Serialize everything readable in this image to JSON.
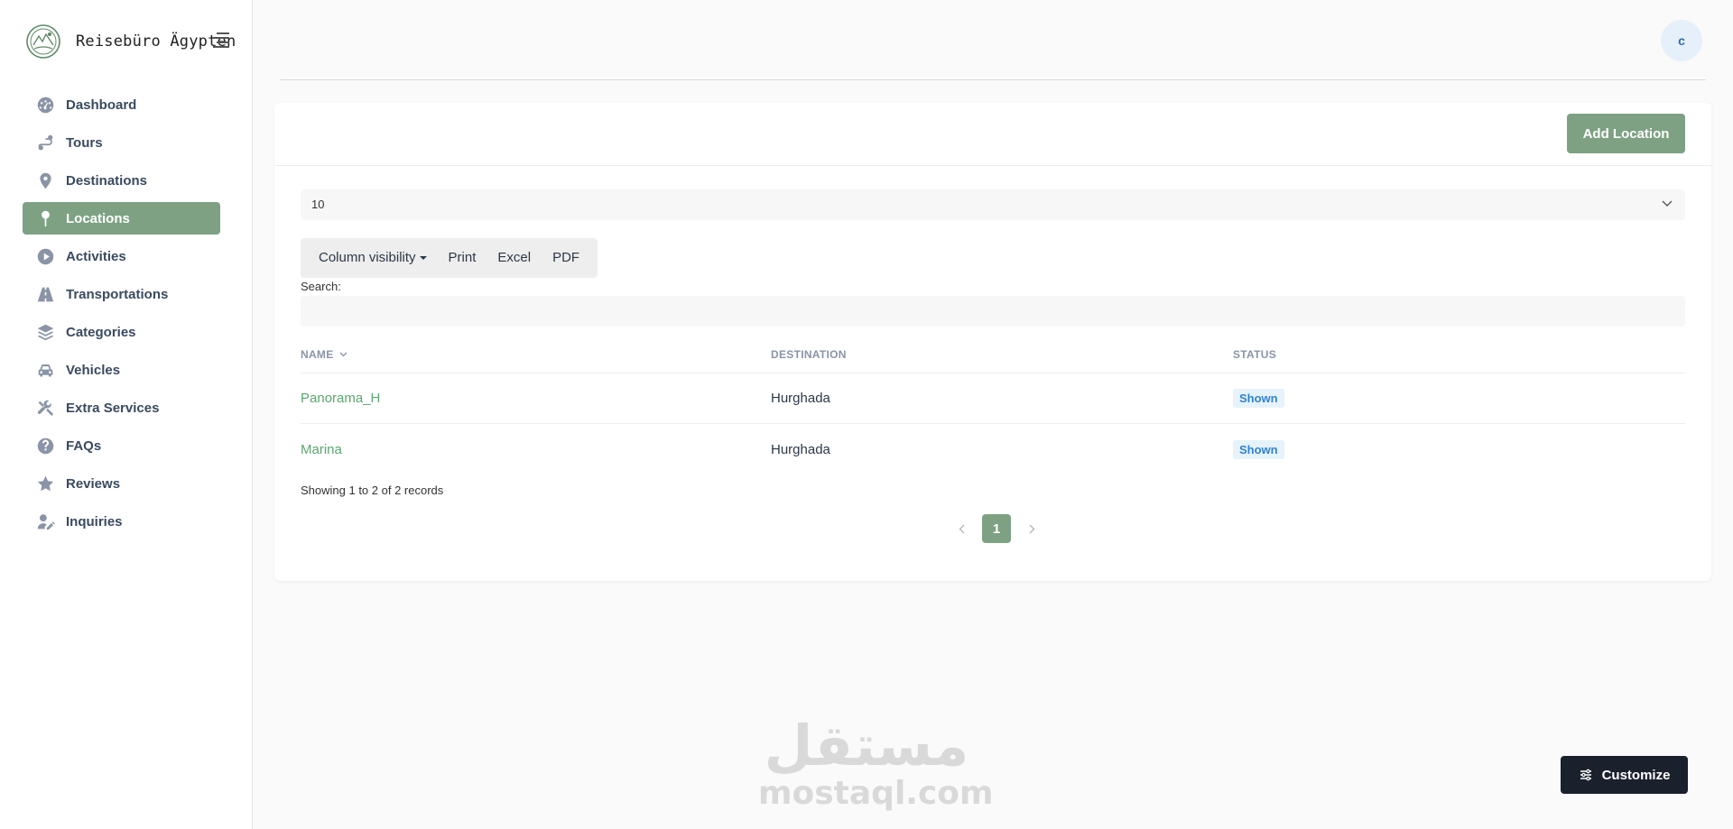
{
  "brand": {
    "name": "Reisebüro Ägypten"
  },
  "sidebar": {
    "items": [
      {
        "label": "Dashboard",
        "icon": "dashboard-gauge-icon"
      },
      {
        "label": "Tours",
        "icon": "route-icon"
      },
      {
        "label": "Destinations",
        "icon": "map-pin-icon"
      },
      {
        "label": "Locations",
        "icon": "map-pin-thin-icon",
        "active": true
      },
      {
        "label": "Activities",
        "icon": "play-circle-icon"
      },
      {
        "label": "Transportations",
        "icon": "road-icon"
      },
      {
        "label": "Categories",
        "icon": "layers-icon"
      },
      {
        "label": "Vehicles",
        "icon": "car-icon"
      },
      {
        "label": "Extra Services",
        "icon": "tools-icon"
      },
      {
        "label": "FAQs",
        "icon": "question-circle-icon"
      },
      {
        "label": "Reviews",
        "icon": "star-icon"
      },
      {
        "label": "Inquiries",
        "icon": "user-edit-icon"
      }
    ]
  },
  "header": {
    "avatar_initial": "c"
  },
  "card": {
    "add_button": "Add Location",
    "page_length": "10",
    "toolbar": {
      "column_visibility": "Column visibility",
      "print": "Print",
      "excel": "Excel",
      "pdf": "PDF"
    },
    "search_label": "Search:",
    "search_value": ""
  },
  "table": {
    "columns": [
      "NAME",
      "DESTINATION",
      "STATUS"
    ],
    "rows": [
      {
        "name": "Panorama_H",
        "destination": "Hurghada",
        "status": "Shown"
      },
      {
        "name": "Marina",
        "destination": "Hurghada",
        "status": "Shown"
      }
    ]
  },
  "info": {
    "records": "Showing 1 to 2 of 2 records"
  },
  "pagination": {
    "current": "1"
  },
  "watermark": {
    "arabic": "مستقل",
    "latin": "mostaql.com"
  },
  "customize_button": "Customize",
  "colors": {
    "accent": "#7ea184",
    "badge_bg": "#e6f3fb",
    "badge_text": "#3182ce",
    "link": "#5aa670",
    "dark_button": "#1a202c"
  }
}
